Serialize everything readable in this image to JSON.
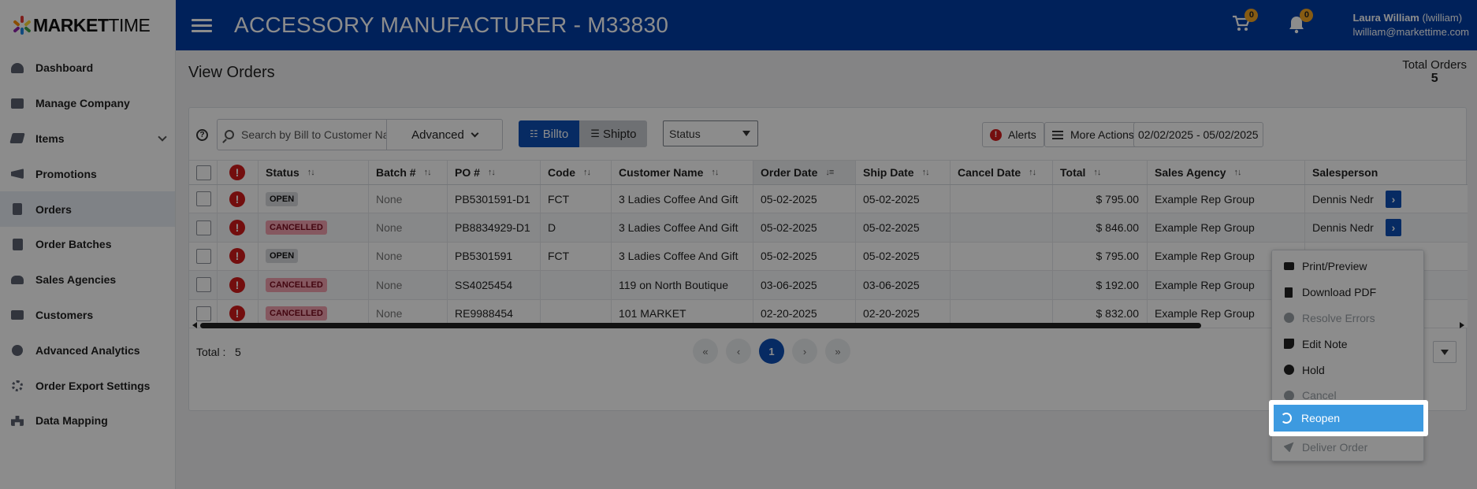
{
  "header": {
    "logo_bold": "MARKET",
    "logo_light": "TIME",
    "app_title": "ACCESSORY MANUFACTURER - M33830",
    "cart_count": "0",
    "notif_count": "0",
    "user_name": "Laura William",
    "user_login": "(lwilliam)",
    "user_email": "lwilliam@markettime.com"
  },
  "sidebar": {
    "items": [
      {
        "label": "Dashboard",
        "icon": "dashboard-icon"
      },
      {
        "label": "Manage Company",
        "icon": "company-icon"
      },
      {
        "label": "Items",
        "icon": "tags-icon"
      },
      {
        "label": "Promotions",
        "icon": "megaphone-icon"
      },
      {
        "label": "Orders",
        "icon": "document-icon"
      },
      {
        "label": "Order Batches",
        "icon": "batches-icon"
      },
      {
        "label": "Sales Agencies",
        "icon": "users-icon"
      },
      {
        "label": "Customers",
        "icon": "id-card-icon"
      },
      {
        "label": "Advanced Analytics",
        "icon": "pie-chart-icon"
      },
      {
        "label": "Order Export Settings",
        "icon": "gears-icon"
      },
      {
        "label": "Data Mapping",
        "icon": "sitemap-icon"
      }
    ]
  },
  "page": {
    "title": "View Orders",
    "total_orders_label": "Total Orders",
    "total_orders_value": "5"
  },
  "toolbar": {
    "help": "?",
    "search_placeholder": "Search by Bill to Customer Na",
    "advanced_label": "Advanced",
    "billto_label": "Billto",
    "shipto_label": "Shipto",
    "status_label": "Status",
    "alerts_label": "Alerts",
    "more_actions_label": "More Actions",
    "date_range": "02/02/2025 - 05/02/2025"
  },
  "table": {
    "headers": [
      "Status",
      "Batch #",
      "PO #",
      "Code",
      "Customer Name",
      "Order Date",
      "Ship Date",
      "Cancel Date",
      "Total",
      "Sales Agency",
      "Salesperson"
    ],
    "rows": [
      {
        "status": "OPEN",
        "batch": "None",
        "po": "PB5301591-D1",
        "code": "FCT",
        "customer": "3 Ladies Coffee And Gift",
        "order_date": "05-02-2025",
        "ship_date": "05-02-2025",
        "cancel_date": "",
        "total": "$ 795.00",
        "agency": "Example Rep Group",
        "salesperson": "Dennis Nedr"
      },
      {
        "status": "CANCELLED",
        "batch": "None",
        "po": "PB8834929-D1",
        "code": "D",
        "customer": "3 Ladies Coffee And Gift",
        "order_date": "05-02-2025",
        "ship_date": "05-02-2025",
        "cancel_date": "",
        "total": "$ 846.00",
        "agency": "Example Rep Group",
        "salesperson": "Dennis Nedr"
      },
      {
        "status": "OPEN",
        "batch": "None",
        "po": "PB5301591",
        "code": "FCT",
        "customer": "3 Ladies Coffee And Gift",
        "order_date": "05-02-2025",
        "ship_date": "05-02-2025",
        "cancel_date": "",
        "total": "$ 795.00",
        "agency": "Example Rep Group",
        "salesperson": ""
      },
      {
        "status": "CANCELLED",
        "batch": "None",
        "po": "SS4025454",
        "code": "",
        "customer": "119 on North Boutique",
        "order_date": "03-06-2025",
        "ship_date": "03-06-2025",
        "cancel_date": "",
        "total": "$ 192.00",
        "agency": "Example Rep Group",
        "salesperson": ""
      },
      {
        "status": "CANCELLED",
        "batch": "None",
        "po": "RE9988454",
        "code": "",
        "customer": "101 MARKET",
        "order_date": "02-20-2025",
        "ship_date": "02-20-2025",
        "cancel_date": "",
        "total": "$ 832.00",
        "agency": "Example Rep Group",
        "salesperson": ""
      }
    ]
  },
  "footer": {
    "total_label": "Total :",
    "total_value": "5",
    "pages": [
      "«",
      "‹",
      "1",
      "›",
      "»"
    ]
  },
  "menu": {
    "items": [
      {
        "label": "Print/Preview",
        "disabled": false
      },
      {
        "label": "Download PDF",
        "disabled": false
      },
      {
        "label": "Resolve Errors",
        "disabled": true
      },
      {
        "label": "Edit Note",
        "disabled": false
      },
      {
        "label": "Hold",
        "disabled": false
      },
      {
        "label": "Cancel",
        "disabled": true
      },
      {
        "label": "Reopen",
        "disabled": false
      },
      {
        "label": "Deliver Order",
        "disabled": true
      }
    ]
  },
  "colors": {
    "brand_blue": "#003da5",
    "primary": "#0d4fb5",
    "highlight": "#3d9ae0",
    "error_red": "#d11a1a",
    "cancel_pill": "#f2a1b0"
  }
}
